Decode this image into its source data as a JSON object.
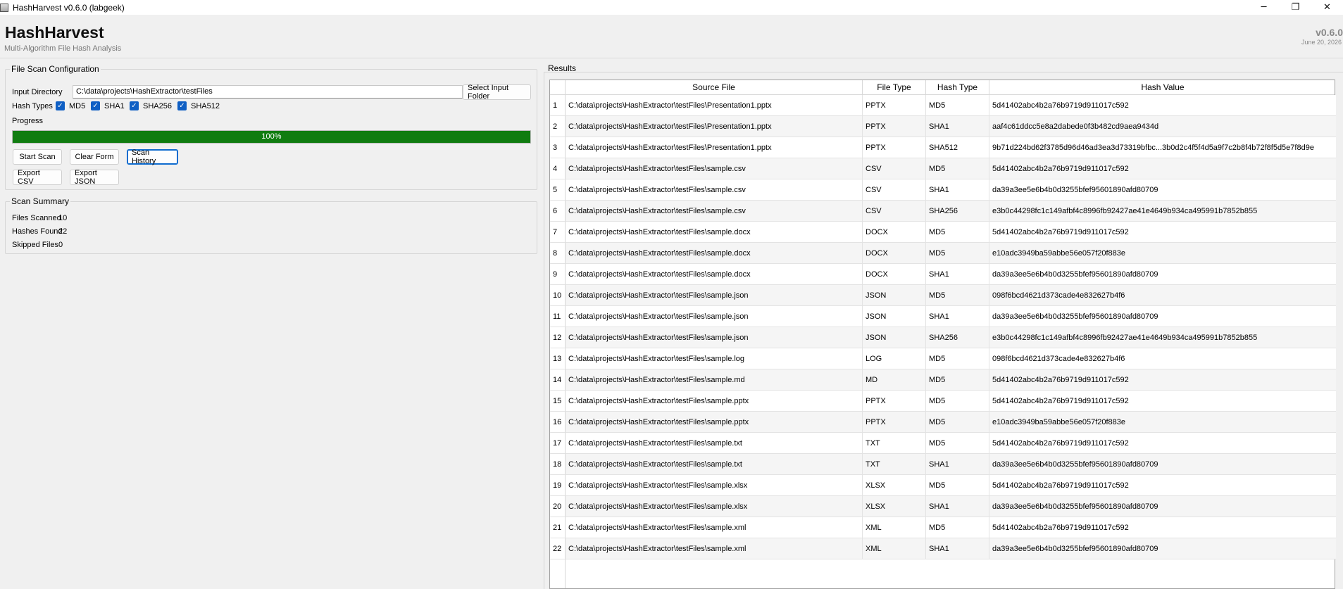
{
  "window": {
    "title": "HashHarvest v0.6.0 (labgeek)",
    "controls": {
      "minimize": "─",
      "maximize": "❐",
      "close": "✕"
    }
  },
  "header": {
    "brand": "HashHarvest",
    "subtitle": "Multi-Algorithm File Hash Analysis",
    "version": "v0.6.0",
    "date": "June 20, 2026"
  },
  "config": {
    "group_title": "File Scan Configuration",
    "input_label": "Input Directory",
    "input_value": "C:\\data\\projects\\HashExtractor\\testFiles",
    "select_folder_label": "Select Input Folder",
    "hash_types_label": "Hash Types",
    "hash_types": [
      {
        "label": "MD5",
        "checked": true
      },
      {
        "label": "SHA1",
        "checked": true
      },
      {
        "label": "SHA256",
        "checked": true
      },
      {
        "label": "SHA512",
        "checked": true
      }
    ],
    "check_glyph": "✓",
    "progress_label": "Progress",
    "progress_percent": 100,
    "progress_text": "100%",
    "buttons": {
      "start_scan": "Start Scan",
      "clear_form": "Clear Form",
      "scan_history": "Scan History",
      "export_csv": "Export CSV",
      "export_json": "Export JSON"
    }
  },
  "summary": {
    "group_title": "Scan Summary",
    "files_scanned_label": "Files Scanned",
    "files_scanned": "10",
    "hashes_found_label": "Hashes Found",
    "hashes_found": "22",
    "skipped_files_label": "Skipped Files",
    "skipped_files": "0"
  },
  "results": {
    "label": "Results",
    "columns": [
      "Source File",
      "File Type",
      "Hash Type",
      "Hash Value"
    ],
    "rows": [
      [
        "1",
        "C:\\data\\projects\\HashExtractor\\testFiles\\Presentation1.pptx",
        "PPTX",
        "MD5",
        "5d41402abc4b2a76b9719d911017c592"
      ],
      [
        "2",
        "C:\\data\\projects\\HashExtractor\\testFiles\\Presentation1.pptx",
        "PPTX",
        "SHA1",
        "aaf4c61ddcc5e8a2dabede0f3b482cd9aea9434d"
      ],
      [
        "3",
        "C:\\data\\projects\\HashExtractor\\testFiles\\Presentation1.pptx",
        "PPTX",
        "SHA512",
        "9b71d224bd62f3785d96d46ad3ea3d73319bfbc...3b0d2c4f5f4d5a9f7c2b8f4b72f8f5d5e7f8d9e"
      ],
      [
        "4",
        "C:\\data\\projects\\HashExtractor\\testFiles\\sample.csv",
        "CSV",
        "MD5",
        "5d41402abc4b2a76b9719d911017c592"
      ],
      [
        "5",
        "C:\\data\\projects\\HashExtractor\\testFiles\\sample.csv",
        "CSV",
        "SHA1",
        "da39a3ee5e6b4b0d3255bfef95601890afd80709"
      ],
      [
        "6",
        "C:\\data\\projects\\HashExtractor\\testFiles\\sample.csv",
        "CSV",
        "SHA256",
        "e3b0c44298fc1c149afbf4c8996fb92427ae41e4649b934ca495991b7852b855"
      ],
      [
        "7",
        "C:\\data\\projects\\HashExtractor\\testFiles\\sample.docx",
        "DOCX",
        "MD5",
        "5d41402abc4b2a76b9719d911017c592"
      ],
      [
        "8",
        "C:\\data\\projects\\HashExtractor\\testFiles\\sample.docx",
        "DOCX",
        "MD5",
        "e10adc3949ba59abbe56e057f20f883e"
      ],
      [
        "9",
        "C:\\data\\projects\\HashExtractor\\testFiles\\sample.docx",
        "DOCX",
        "SHA1",
        "da39a3ee5e6b4b0d3255bfef95601890afd80709"
      ],
      [
        "10",
        "C:\\data\\projects\\HashExtractor\\testFiles\\sample.json",
        "JSON",
        "MD5",
        "098f6bcd4621d373cade4e832627b4f6"
      ],
      [
        "11",
        "C:\\data\\projects\\HashExtractor\\testFiles\\sample.json",
        "JSON",
        "SHA1",
        "da39a3ee5e6b4b0d3255bfef95601890afd80709"
      ],
      [
        "12",
        "C:\\data\\projects\\HashExtractor\\testFiles\\sample.json",
        "JSON",
        "SHA256",
        "e3b0c44298fc1c149afbf4c8996fb92427ae41e4649b934ca495991b7852b855"
      ],
      [
        "13",
        "C:\\data\\projects\\HashExtractor\\testFiles\\sample.log",
        "LOG",
        "MD5",
        "098f6bcd4621d373cade4e832627b4f6"
      ],
      [
        "14",
        "C:\\data\\projects\\HashExtractor\\testFiles\\sample.md",
        "MD",
        "MD5",
        "5d41402abc4b2a76b9719d911017c592"
      ],
      [
        "15",
        "C:\\data\\projects\\HashExtractor\\testFiles\\sample.pptx",
        "PPTX",
        "MD5",
        "5d41402abc4b2a76b9719d911017c592"
      ],
      [
        "16",
        "C:\\data\\projects\\HashExtractor\\testFiles\\sample.pptx",
        "PPTX",
        "MD5",
        "e10adc3949ba59abbe56e057f20f883e"
      ],
      [
        "17",
        "C:\\data\\projects\\HashExtractor\\testFiles\\sample.txt",
        "TXT",
        "MD5",
        "5d41402abc4b2a76b9719d911017c592"
      ],
      [
        "18",
        "C:\\data\\projects\\HashExtractor\\testFiles\\sample.txt",
        "TXT",
        "SHA1",
        "da39a3ee5e6b4b0d3255bfef95601890afd80709"
      ],
      [
        "19",
        "C:\\data\\projects\\HashExtractor\\testFiles\\sample.xlsx",
        "XLSX",
        "MD5",
        "5d41402abc4b2a76b9719d911017c592"
      ],
      [
        "20",
        "C:\\data\\projects\\HashExtractor\\testFiles\\sample.xlsx",
        "XLSX",
        "SHA1",
        "da39a3ee5e6b4b0d3255bfef95601890afd80709"
      ],
      [
        "21",
        "C:\\data\\projects\\HashExtractor\\testFiles\\sample.xml",
        "XML",
        "MD5",
        "5d41402abc4b2a76b9719d911017c592"
      ],
      [
        "22",
        "C:\\data\\projects\\HashExtractor\\testFiles\\sample.xml",
        "XML",
        "SHA1",
        "da39a3ee5e6b4b0d3255bfef95601890afd80709"
      ]
    ]
  },
  "colors": {
    "progress_fill": "#107c10",
    "checkbox": "#0f5fc4",
    "focus_border": "#0f6ccf"
  }
}
